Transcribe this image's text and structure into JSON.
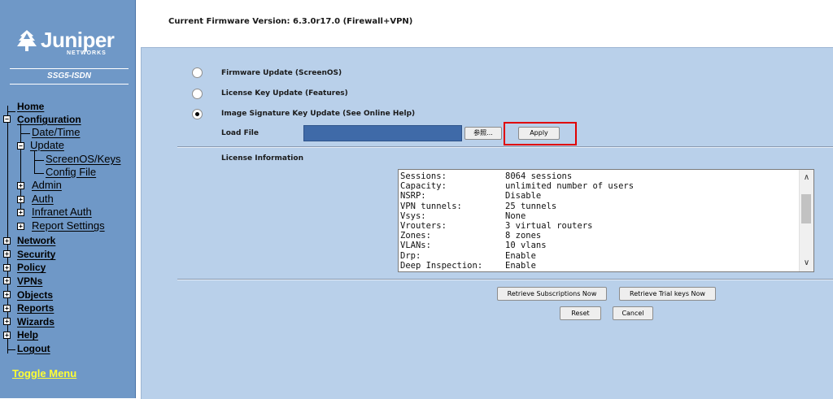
{
  "sidebar": {
    "logo_text": "Juniper",
    "logo_sub": "NETWORKS",
    "model": "SSG5-ISDN",
    "nav": {
      "home": "Home",
      "configuration": "Configuration",
      "date_time": "Date/Time",
      "update": "Update",
      "screenos_keys": "ScreenOS/Keys",
      "config_file": "Config File",
      "admin": "Admin",
      "auth": "Auth",
      "infranet_auth": "Infranet Auth",
      "report_settings": "Report Settings",
      "network": "Network",
      "security": "Security",
      "policy": "Policy",
      "vpns": "VPNs",
      "objects": "Objects",
      "reports": "Reports",
      "wizards": "Wizards",
      "help": "Help",
      "logout": "Logout"
    },
    "toggle_menu": "Toggle Menu",
    "colors": {
      "background": "#6f98c7",
      "toggle_text": "#ffff33"
    }
  },
  "header": {
    "firmware_version": "Current Firmware Version: 6.3.0r17.0 (Firewall+VPN)"
  },
  "update_options": [
    {
      "label": "Firmware Update (ScreenOS)",
      "selected": false
    },
    {
      "label": "License Key Update (Features)",
      "selected": false
    },
    {
      "label": "Image Signature Key Update (See Online Help)",
      "selected": true
    }
  ],
  "load_file": {
    "label": "Load File",
    "value": "",
    "browse_label": "参照...",
    "apply_label": "Apply"
  },
  "license": {
    "heading": "License Information",
    "rows": [
      {
        "key": "Sessions:",
        "value": "8064 sessions"
      },
      {
        "key": "Capacity:",
        "value": "unlimited number of users"
      },
      {
        "key": "NSRP:",
        "value": "Disable"
      },
      {
        "key": "VPN tunnels:",
        "value": "25 tunnels"
      },
      {
        "key": "Vsys:",
        "value": "None"
      },
      {
        "key": "Vrouters:",
        "value": "3 virtual routers"
      },
      {
        "key": "Zones:",
        "value": "8 zones"
      },
      {
        "key": "VLANs:",
        "value": "10 vlans"
      },
      {
        "key": "Drp:",
        "value": "Enable"
      },
      {
        "key": "Deep Inspection:",
        "value": "Enable"
      }
    ]
  },
  "buttons": {
    "retrieve_subscriptions": "Retrieve Subscriptions Now",
    "retrieve_trial_keys": "Retrieve Trial keys Now",
    "reset": "Reset",
    "cancel": "Cancel"
  },
  "colors": {
    "content_bg": "#b9d0ea",
    "highlight": "#e00000",
    "file_input_bg": "#3f6aa8"
  }
}
